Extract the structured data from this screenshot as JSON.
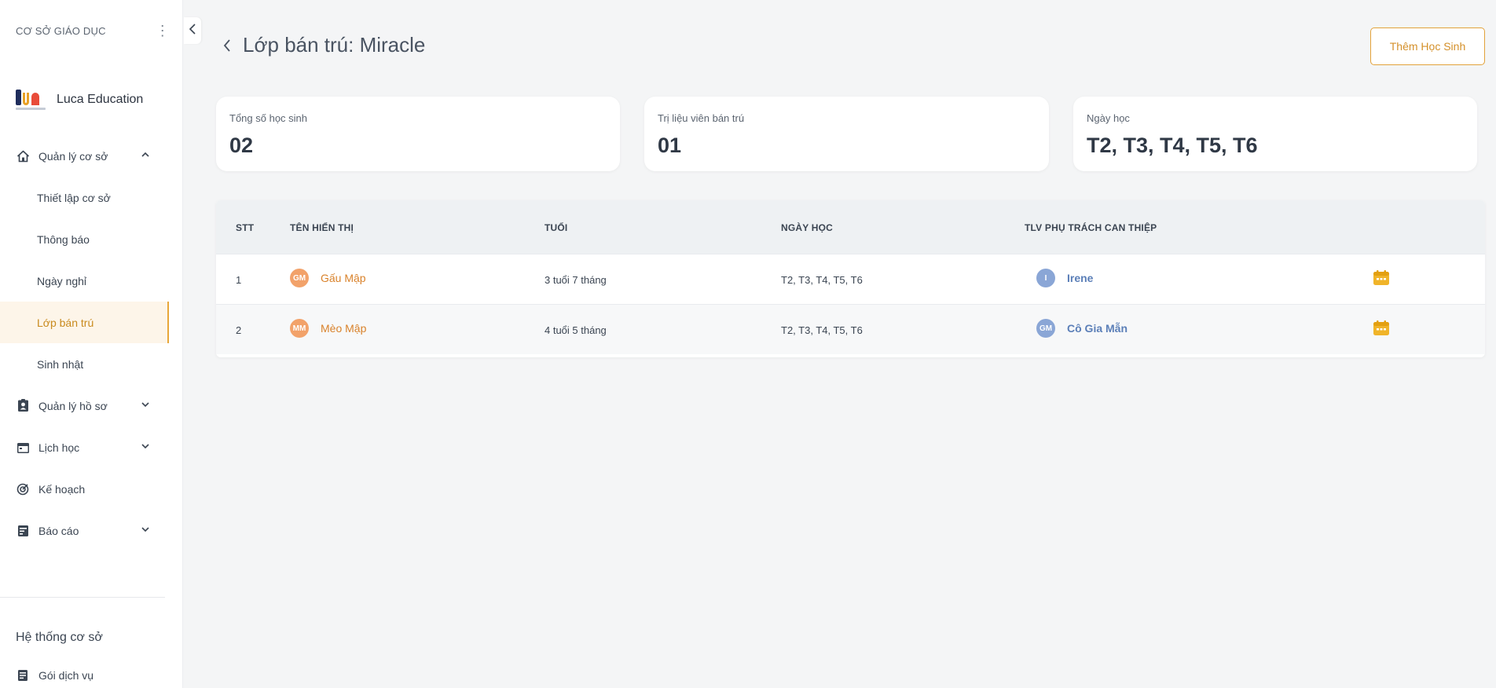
{
  "sidebar": {
    "org_label": "CƠ SỞ GIÁO DỤC",
    "brand_name": "Luca Education",
    "nav": {
      "facility_management": "Quản lý cơ sở",
      "sub_items": {
        "setup": "Thiết lập cơ sở",
        "notifications": "Thông báo",
        "holidays": "Ngày nghỉ",
        "daycare": "Lớp bán trú",
        "birthdays": "Sinh nhật"
      },
      "records": "Quản lý hồ sơ",
      "schedule": "Lịch học",
      "plan": "Kế hoạch",
      "reports": "Báo cáo"
    },
    "system_title": "Hệ thống cơ sở",
    "service_package": "Gói dịch vụ"
  },
  "header": {
    "title": "Lớp bán trú: Miracle",
    "add_button": "Thêm Học Sinh"
  },
  "stats": {
    "total_students_label": "Tổng số học sinh",
    "total_students_value": "02",
    "therapists_label": "Trị liệu viên bán trú",
    "therapists_value": "01",
    "days_label": "Ngày học",
    "days_value": "T2, T3, T4, T5, T6"
  },
  "table": {
    "headers": {
      "index": "STT",
      "name": "TÊN HIỂN THỊ",
      "age": "TUỔI",
      "days": "NGÀY HỌC",
      "therapist": "TLV PHỤ TRÁCH CAN THIỆP"
    },
    "rows": [
      {
        "index": "1",
        "initials": "GM",
        "name": "Gấu Mập",
        "age": "3 tuổi 7 tháng",
        "days": "T2, T3, T4, T5, T6",
        "therapist_initials": "I",
        "therapist": "Irene"
      },
      {
        "index": "2",
        "initials": "MM",
        "name": "Mèo Mập",
        "age": "4 tuổi 5 tháng",
        "days": "T2, T3, T4, T5, T6",
        "therapist_initials": "GM",
        "therapist": "Cô Gia Mẫn"
      }
    ]
  },
  "colors": {
    "accent": "#e2a23a",
    "student_avatar": "#f2a26a",
    "therapist_avatar": "#8aa6d6",
    "calendar_icon": "#f0b429"
  }
}
